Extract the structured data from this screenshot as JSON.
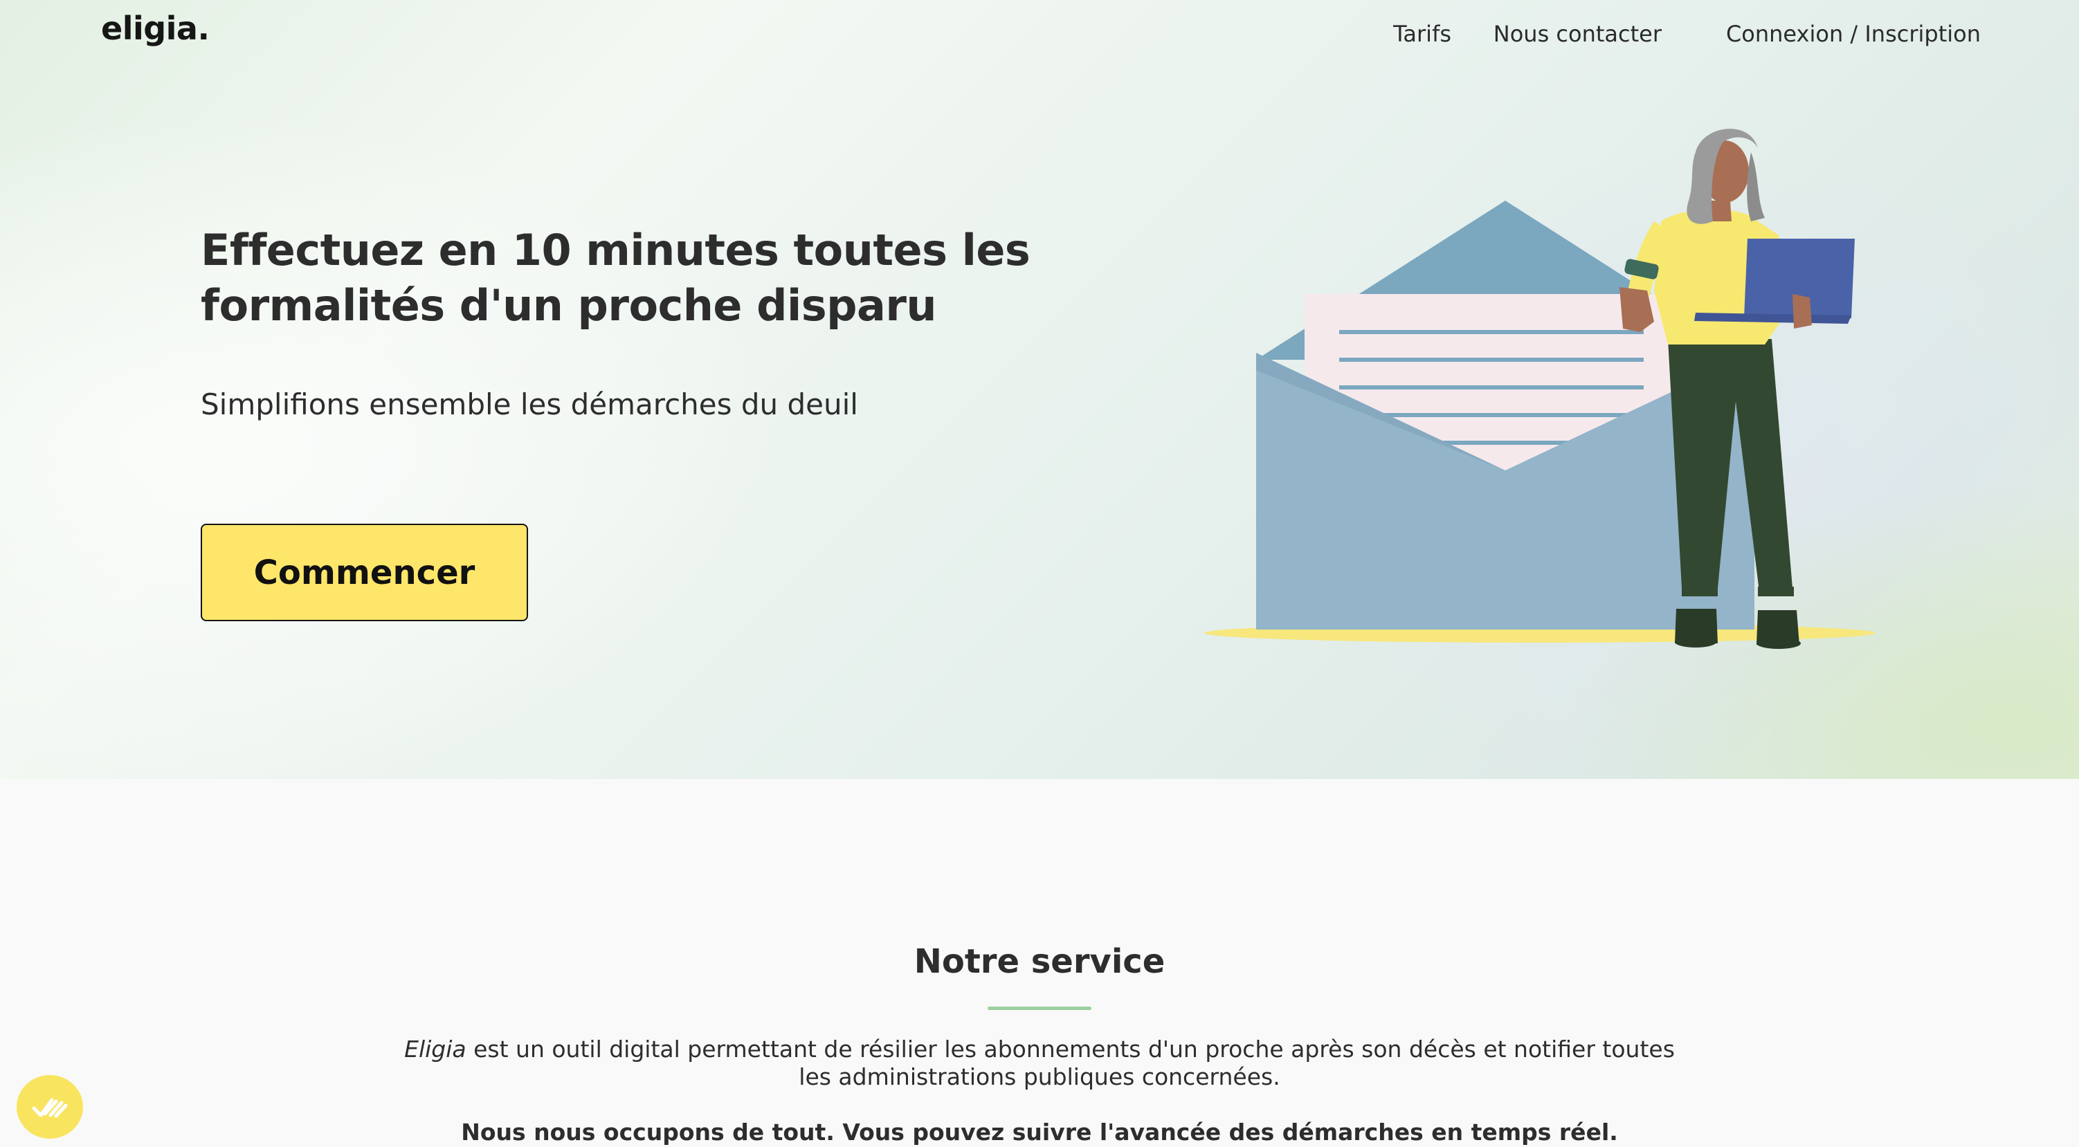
{
  "header": {
    "logo": "eligia.",
    "nav": [
      {
        "label": "Tarifs"
      },
      {
        "label": "Nous contacter"
      },
      {
        "label": "Connexion / Inscription"
      }
    ]
  },
  "hero": {
    "title": "Effectuez en 10 minutes toutes les formalités d'un proche disparu",
    "subtitle": "Simplifions ensemble les démarches du deuil",
    "cta_label": "Commencer"
  },
  "service": {
    "title": "Notre service",
    "description_brand": "Eligia",
    "description_rest": " est un outil digital permettant de résilier les abonnements d'un proche après son décès et notifier toutes les administrations publiques concernées.",
    "highlight": "Nous nous occupons de tout. Vous pouvez suivre l'avancée des démarches en temps réel."
  },
  "colors": {
    "accent_yellow": "#fde66a",
    "rule_green": "#9ccf9f",
    "text_dark": "#2d2d2d"
  },
  "icons": {
    "chat_widget": "check-marks-icon"
  }
}
